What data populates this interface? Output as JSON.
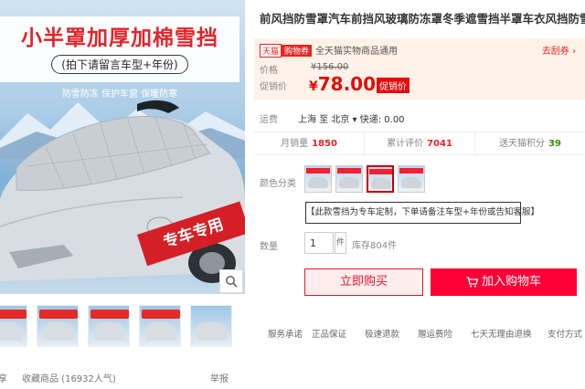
{
  "gallery": {
    "promo_title": "小半罩加厚加棉雪挡",
    "promo_sub": "(拍下请留言车型+年份)",
    "promo_features": "防雪防冻  保护车窗  保暖防寒",
    "stamp": "专车专用",
    "zoom_icon": "search-icon",
    "thumb_count": 5
  },
  "under_gallery": {
    "left_mark": "享",
    "favorites": "收藏商品  (16932人气)",
    "report": "举报"
  },
  "product": {
    "title": "前风挡防雪罩汽车前挡风玻璃防冻罩冬季遮雪挡半罩车衣风挡防雪布",
    "tmall_tag": "天猫",
    "gouwujin_tag": "购物券",
    "tmall_text": "全天猫实物商品通用",
    "coupon_link": "去刮券 ›",
    "price_label": "价格",
    "orig_price": "¥156.00",
    "promo_label": "促销价",
    "promo_currency": "¥",
    "promo_price": "78.00",
    "promo_badge": "促销价"
  },
  "delivery": {
    "label": "运费",
    "route": "上海 至 北京 ▾  快递: 0.00"
  },
  "stats": [
    {
      "label": "月销量",
      "value": "1850"
    },
    {
      "label": "累计评价",
      "value": "7041"
    },
    {
      "label": "送天猫积分",
      "value": "39"
    }
  ],
  "options": {
    "color_label": "颜色分类",
    "note": "【此款雪挡为专车定制，下单请备注车型+年份或告知客服】",
    "qty_label": "数量",
    "qty_value": "1",
    "qty_unit": "件",
    "stock": "库存804件"
  },
  "actions": {
    "buy_now": "立即购买",
    "add_cart": "加入购物车",
    "cart_icon": "cart-icon"
  },
  "services": {
    "label": "服务承诺",
    "items": [
      "正品保证",
      "极速退款",
      "赠运费险",
      "七天无理由退换",
      "支付方式 ▾"
    ]
  },
  "colors": {
    "accent": "#e5152e",
    "price": "#e40c0c",
    "price_bg": "#fff2e8"
  }
}
